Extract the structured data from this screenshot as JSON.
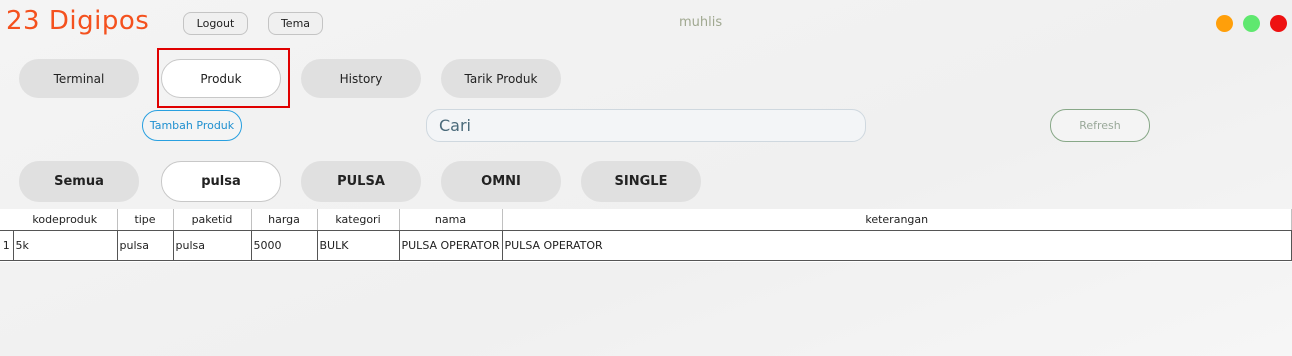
{
  "app": {
    "title": "23 Digipos",
    "username": "muhlis"
  },
  "header": {
    "logout_label": "Logout",
    "theme_label": "Tema"
  },
  "window_controls": {
    "minimize_color": "#ff9f0a",
    "maximize_color": "#5fe86f",
    "close_color": "#ee1111"
  },
  "nav": {
    "tabs": [
      {
        "label": "Terminal",
        "active": false
      },
      {
        "label": "Produk",
        "active": true
      },
      {
        "label": "History",
        "active": false
      },
      {
        "label": "Tarik Produk",
        "active": false
      }
    ]
  },
  "toolbar": {
    "add_label": "Tambah Produk",
    "search_placeholder": "Cari",
    "refresh_label": "Refresh"
  },
  "filters": [
    {
      "label": "Semua",
      "active": false
    },
    {
      "label": "pulsa",
      "active": true
    },
    {
      "label": "PULSA",
      "active": false
    },
    {
      "label": "OMNI",
      "active": false
    },
    {
      "label": "SINGLE",
      "active": false
    }
  ],
  "table": {
    "columns": [
      "kodeproduk",
      "tipe",
      "paketid",
      "harga",
      "kategori",
      "nama",
      "keterangan"
    ],
    "rows": [
      {
        "index": "1",
        "cells": [
          "5k",
          "pulsa",
          "pulsa",
          "5000",
          "BULK",
          "PULSA OPERATOR",
          "PULSA OPERATOR"
        ]
      }
    ]
  },
  "colors": {
    "accent": "#f4511e",
    "highlight": "#e00000"
  }
}
